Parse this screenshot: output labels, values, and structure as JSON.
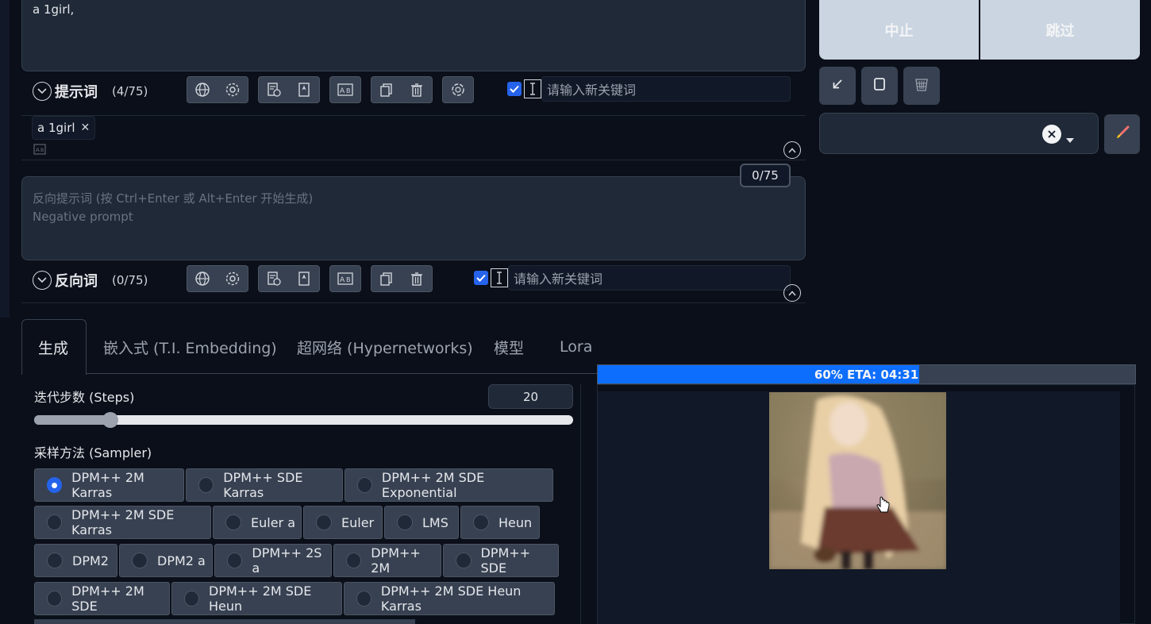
{
  "prompt": {
    "text": "a 1girl,",
    "section_label": "提示词",
    "count": "(4/75)",
    "keyword_placeholder": "请输入新关键词",
    "tag": "a 1girl"
  },
  "negative": {
    "placeholder_line1": "反向提示词 (按 Ctrl+Enter 或 Alt+Enter 开始生成)",
    "placeholder_line2": "Negative prompt",
    "counter": "0/75",
    "section_label": "反向词",
    "count": "(0/75)",
    "keyword_placeholder": "请输入新关键词"
  },
  "actions": {
    "interrupt": "中止",
    "skip": "跳过"
  },
  "tabs": [
    {
      "label": "生成"
    },
    {
      "label": "嵌入式 (T.I. Embedding)"
    },
    {
      "label": "超网络 (Hypernetworks)"
    },
    {
      "label": "模型"
    },
    {
      "label": "Lora"
    }
  ],
  "steps": {
    "label": "迭代步数 (Steps)",
    "value": "20",
    "slider_fraction": 0.13
  },
  "sampler": {
    "label": "采样方法 (Sampler)",
    "selected": "DPM++ 2M Karras",
    "options": [
      "DPM++ 2M Karras",
      "DPM++ SDE Karras",
      "DPM++ 2M SDE Exponential",
      "DPM++ 2M SDE Karras",
      "Euler a",
      "Euler",
      "LMS",
      "Heun",
      "DPM2",
      "DPM2 a",
      "DPM++ 2S a",
      "DPM++ 2M",
      "DPM++ SDE",
      "DPM++ 2M SDE",
      "DPM++ 2M SDE Heun",
      "DPM++ 2M SDE Heun Karras"
    ]
  },
  "progress": {
    "text": "60% ETA: 04:31",
    "fraction": 0.6
  },
  "colors": {
    "accent": "#2563eb",
    "progress_fill": "#0d6efd",
    "background": "#0b0f19"
  }
}
